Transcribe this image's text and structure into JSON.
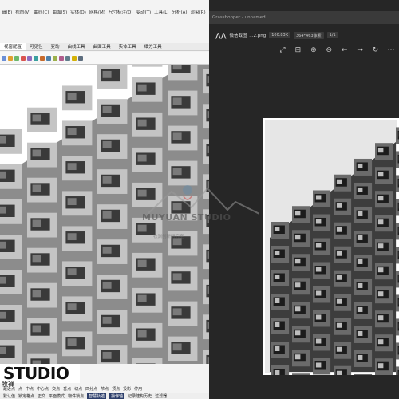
{
  "left_app": {
    "menu": [
      "辑(E)",
      "视图(V)",
      "曲线(C)",
      "曲面(S)",
      "实体(O)",
      "网格(M)",
      "尺寸标注(D)",
      "变动(T)",
      "工具(L)",
      "分析(A)",
      "渲染(R)",
      "面板(P)",
      "说明(H)"
    ],
    "tabs": [
      "视窗配置",
      "可见性",
      "变动",
      "曲线工具",
      "曲面工具",
      "实体工具",
      "细分工具"
    ],
    "toolbar_icons": [
      "arrow-icon",
      "view-icon",
      "zoom-icon",
      "globe-icon",
      "light-icon",
      "camera-icon",
      "render-icon",
      "sphere-icon",
      "material-icon",
      "shade-icon",
      "grid-icon",
      "color-icon",
      "settings-icon"
    ],
    "logo": "STUDIO",
    "signature": "牧禅",
    "status_row1": [
      "最近点",
      "点",
      "中点",
      "中心点",
      "交点",
      "垂点",
      "切点",
      "四分点",
      "节点",
      "顶点",
      "投影",
      "停用"
    ],
    "status_row2": [
      "默认值",
      "锁定格点",
      "正交",
      "平面模式",
      "物件锁点",
      "智慧轨迹",
      "操作轴",
      "记录建构历史",
      "过滤器"
    ]
  },
  "right_app": {
    "window_title": "Grasshopper - unnamed",
    "file_name": "微信截图_...2.png",
    "file_size": "100.83K",
    "dimensions": "364*463像素",
    "page": "1/1",
    "tool_icons": [
      "fit-icon",
      "fullscreen-icon",
      "zoom-in-icon",
      "zoom-out-icon",
      "prev-icon",
      "next-icon",
      "rotate-icon",
      "more-icon"
    ]
  },
  "watermark": {
    "title": "MUYUAN STUDIO",
    "sub1": "牧渊创新研究室"
  },
  "colors": {
    "dark_bg": "#262626",
    "panel_bg": "#f3f3f3",
    "accent": "#2c3e6b"
  }
}
